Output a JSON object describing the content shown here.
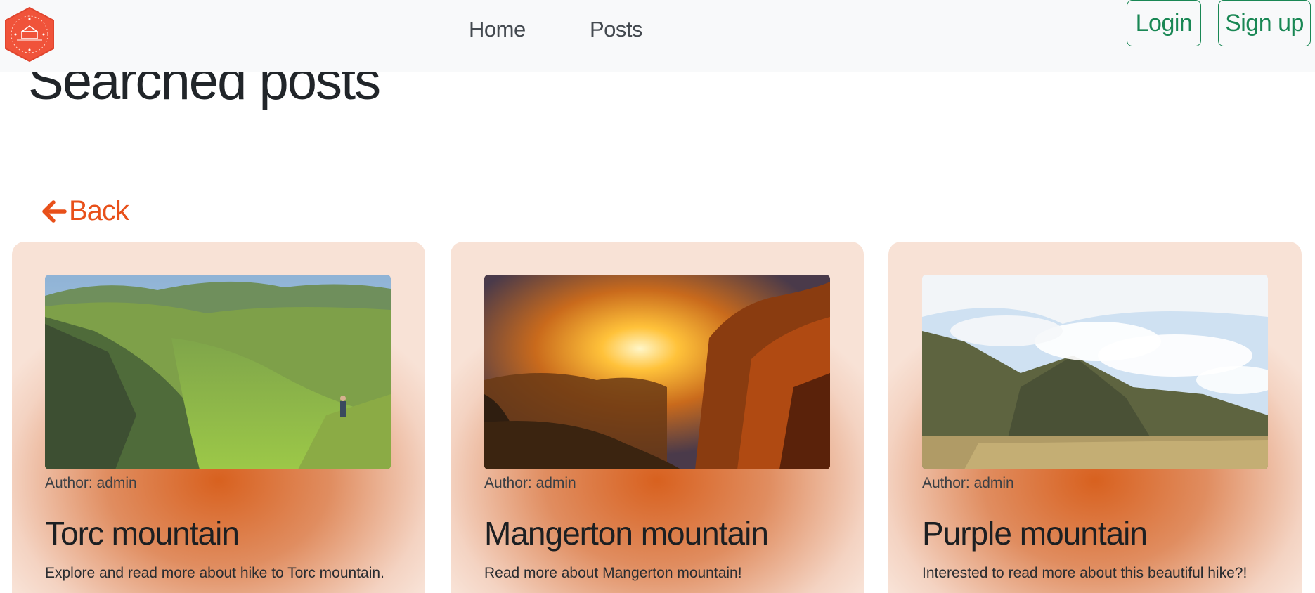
{
  "nav": {
    "logo_icon": "hiking-club-hexagon-logo",
    "links": [
      "Home",
      "Posts"
    ],
    "login_label": "Login",
    "signup_label": "Sign up"
  },
  "page": {
    "title": "Searched posts",
    "back_label": "Back",
    "back_icon": "arrow-left-icon"
  },
  "colors": {
    "accent": "#e8501a",
    "success": "#198754",
    "logo": "#f0533a"
  },
  "posts": [
    {
      "image_icon": "green-valley-hiker-photo",
      "author": "Author: admin",
      "title": "Torc mountain",
      "excerpt": "Explore and read more about hike to Torc mountain."
    },
    {
      "image_icon": "sunset-forest-mountain-photo",
      "author": "Author: admin",
      "title": "Mangerton mountain",
      "excerpt": "Read more about Mangerton mountain!"
    },
    {
      "image_icon": "cloudy-peak-photo",
      "author": "Author: admin",
      "title": "Purple mountain",
      "excerpt": "Interested to read more about this beautiful hike?!"
    }
  ]
}
